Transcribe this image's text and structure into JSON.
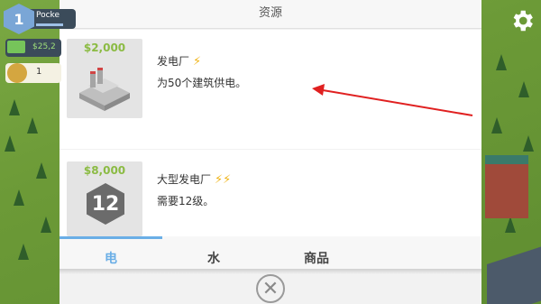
{
  "hud": {
    "level": "1",
    "player_name": "Pocke",
    "money": "$25,2",
    "gold": "1"
  },
  "modal": {
    "title": "资源",
    "items": [
      {
        "price": "$2,000",
        "name": "发电厂",
        "bolts": "⚡",
        "desc": "为50个建筑供电。"
      },
      {
        "price": "$8,000",
        "name": "大型发电厂",
        "bolts": "⚡⚡",
        "desc": "需要12级。",
        "required_level": "12"
      }
    ],
    "tabs": [
      {
        "label": "电",
        "active": true
      },
      {
        "label": "水",
        "active": false
      },
      {
        "label": "商品",
        "active": false
      }
    ],
    "close_symbol": "✕"
  },
  "colors": {
    "price": "#8bbb43",
    "tab_active": "#6aaee6",
    "bolt": "#f0b418",
    "arrow": "#e02020"
  }
}
